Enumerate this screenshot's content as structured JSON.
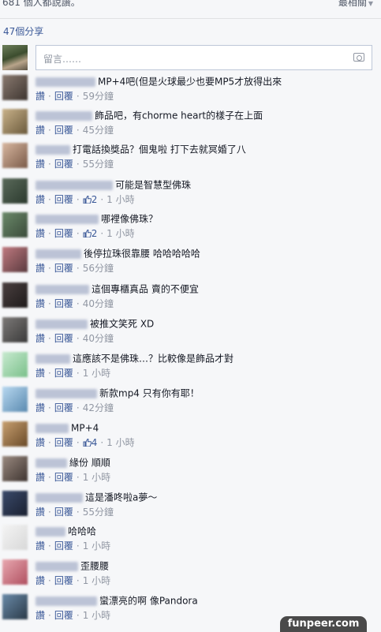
{
  "header": {
    "readers_count": "681 個人都說讚。",
    "sort_label": "最相關"
  },
  "share_count": "47個分享",
  "composer": {
    "placeholder": "留言……"
  },
  "actions": {
    "like": "讚",
    "reply": "回覆"
  },
  "comments": [
    {
      "text": "MP+4吧(但是火球最少也要MP5才放得出來",
      "time": "59分鐘",
      "likes": ""
    },
    {
      "text": "飾品吧，有chorme heart的樣子在上面",
      "time": "45分鐘",
      "likes": ""
    },
    {
      "text": "打電話換獎品？個鬼啦 打下去就冥婚了八",
      "time": "55分鐘",
      "likes": ""
    },
    {
      "text": "可能是智慧型佛珠",
      "time": "1 小時",
      "likes": "2"
    },
    {
      "text": "哪裡像佛珠？",
      "time": "1 小時",
      "likes": "2"
    },
    {
      "text": "後停拉珠很靠腰 哈哈哈哈哈",
      "time": "56分鐘",
      "likes": ""
    },
    {
      "text": "這個專櫃真品 賣的不便宜",
      "time": "40分鐘",
      "likes": ""
    },
    {
      "text": "被推文笑死 XD",
      "time": "40分鐘",
      "likes": ""
    },
    {
      "text": "這應該不是佛珠…？比較像是飾品才對",
      "time": "1 小時",
      "likes": ""
    },
    {
      "text": "新款mp4 只有你有耶！",
      "time": "42分鐘",
      "likes": ""
    },
    {
      "text": "MP+4",
      "time": "1 小時",
      "likes": "4"
    },
    {
      "text": "緣份 順順",
      "time": "1 小時",
      "likes": ""
    },
    {
      "text": "這是潘咚啦a夢～",
      "time": "55分鐘",
      "likes": ""
    },
    {
      "text": "哈哈哈",
      "time": "1 小時",
      "likes": ""
    },
    {
      "text": "歪腰腰",
      "time": "1 小時",
      "likes": ""
    },
    {
      "text": "蠻漂亮的啊 像Pandora",
      "time": "1 小時",
      "likes": ""
    }
  ],
  "watermark": "funpeer.com"
}
